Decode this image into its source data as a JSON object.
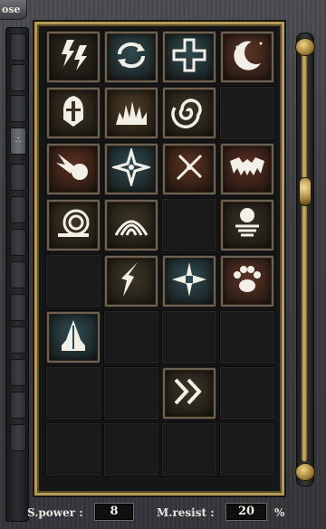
{
  "window": {
    "close_label": "ose"
  },
  "rail": {
    "active_glyph": "∴"
  },
  "skills": [
    {
      "name": "lightning-bolts-icon",
      "bg": "#2e2a22"
    },
    {
      "name": "cycle-arrows-icon",
      "bg": "#2f4950"
    },
    {
      "name": "holy-cross-icon",
      "bg": "#2f4950"
    },
    {
      "name": "crescent-moon-icon",
      "bg": "#5a3424"
    },
    {
      "name": "armored-knight-icon",
      "bg": "#3a3122"
    },
    {
      "name": "burning-flames-icon",
      "bg": "#4a3b26"
    },
    {
      "name": "swirl-vortex-icon",
      "bg": "#3a3425"
    },
    null,
    {
      "name": "meteor-fireball-icon",
      "bg": "#5a2f1f"
    },
    {
      "name": "shuriken-spin-icon",
      "bg": "#2d4950"
    },
    {
      "name": "crossed-sparks-icon",
      "bg": "#5a3020"
    },
    {
      "name": "bat-wings-icon",
      "bg": "#5a2f22"
    },
    {
      "name": "snail-shell-icon",
      "bg": "#3d3424"
    },
    {
      "name": "radiant-wave-icon",
      "bg": "#3b3424"
    },
    null,
    {
      "name": "spirit-orb-icon",
      "bg": "#352f25"
    },
    null,
    {
      "name": "lightning-crack-icon",
      "bg": "#3c3526"
    },
    {
      "name": "starburst-cross-icon",
      "bg": "#2e4952"
    },
    {
      "name": "beast-paw-icon",
      "bg": "#5a3424"
    },
    {
      "name": "praying-hands-icon",
      "bg": "#2d4a52"
    },
    null,
    null,
    null,
    null,
    null,
    {
      "name": "double-chevron-icon",
      "bg": "#3b3526"
    },
    null,
    null,
    null,
    null,
    null
  ],
  "stats": {
    "spower_label": "S.power :",
    "spower_value": "8",
    "mresist_label": "M.resist :",
    "mresist_value": "20",
    "mresist_unit": "%"
  }
}
